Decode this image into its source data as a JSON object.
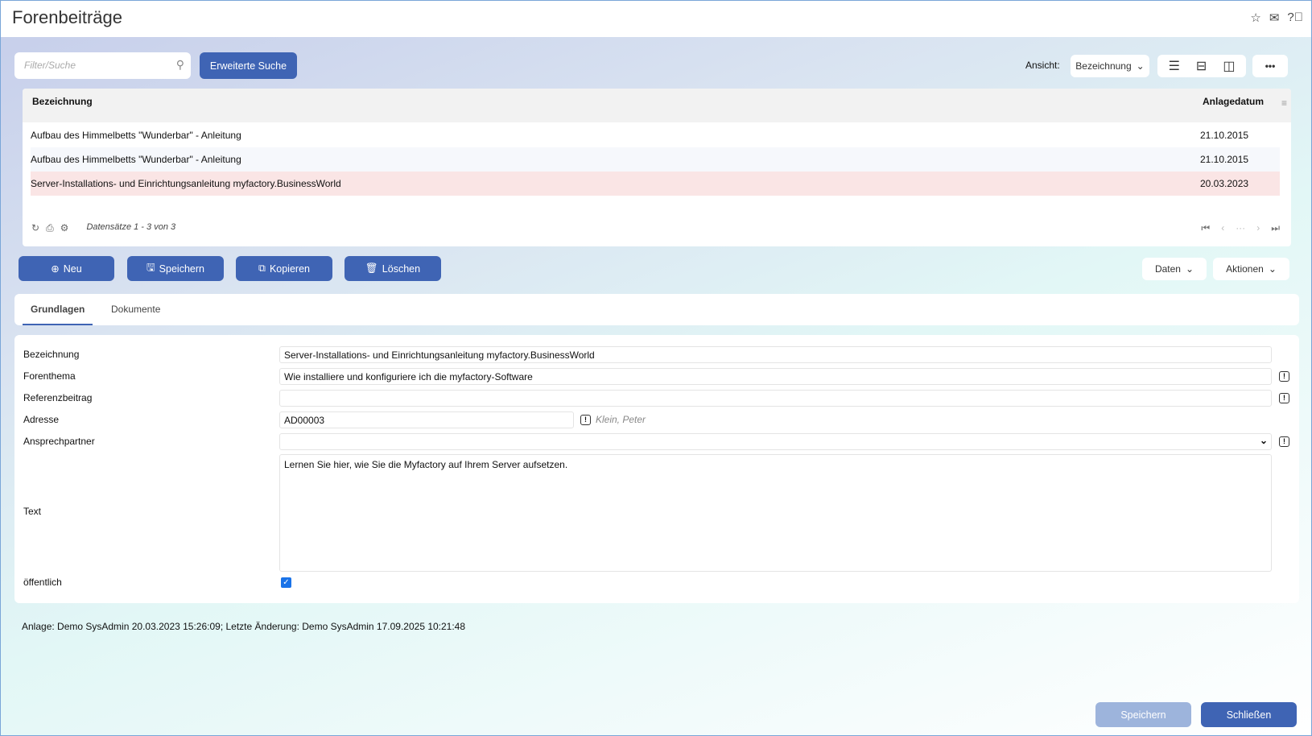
{
  "header": {
    "title": "Forenbeiträge"
  },
  "toolbar": {
    "search_placeholder": "Filter/Suche",
    "advanced_search": "Erweiterte Suche",
    "view_label": "Ansicht:",
    "view_value": "Bezeichnung"
  },
  "grid": {
    "columns": [
      "Bezeichnung",
      "Anlagedatum"
    ],
    "rows": [
      {
        "bezeichnung": "Aufbau des Himmelbetts \"Wunderbar\" - Anleitung",
        "datum": "21.10.2015"
      },
      {
        "bezeichnung": "Aufbau des Himmelbetts \"Wunderbar\" - Anleitung",
        "datum": "21.10.2015"
      },
      {
        "bezeichnung": "Server-Installations- und Einrichtungsanleitung myfactory.BusinessWorld",
        "datum": "20.03.2023"
      }
    ],
    "records": "Datensätze 1 - 3 von 3"
  },
  "actions": {
    "new": "Neu",
    "save": "Speichern",
    "copy": "Kopieren",
    "delete": "Löschen",
    "data": "Daten",
    "actions": "Aktionen"
  },
  "tabs": [
    "Grundlagen",
    "Dokumente"
  ],
  "form": {
    "bezeichnung_label": "Bezeichnung",
    "bezeichnung": "Server-Installations- und Einrichtungsanleitung myfactory.BusinessWorld",
    "forenthema_label": "Forenthema",
    "forenthema": "Wie installiere und konfiguriere ich die myfactory-Software",
    "referenz_label": "Referenzbeitrag",
    "referenz": "",
    "adresse_label": "Adresse",
    "adresse": "AD00003",
    "adresse_name": "Klein, Peter",
    "ansprechpartner_label": "Ansprechpartner",
    "ansprechpartner": "",
    "text_label": "Text",
    "text": "Lernen Sie hier, wie Sie die Myfactory auf Ihrem Server aufsetzen.",
    "oeffentlich_label": "öffentlich",
    "oeffentlich": true
  },
  "footer": {
    "info": "Anlage: Demo SysAdmin 20.03.2023 15:26:09; Letzte Änderung: Demo SysAdmin 17.09.2025 10:21:48",
    "save": "Speichern",
    "close": "Schließen"
  }
}
